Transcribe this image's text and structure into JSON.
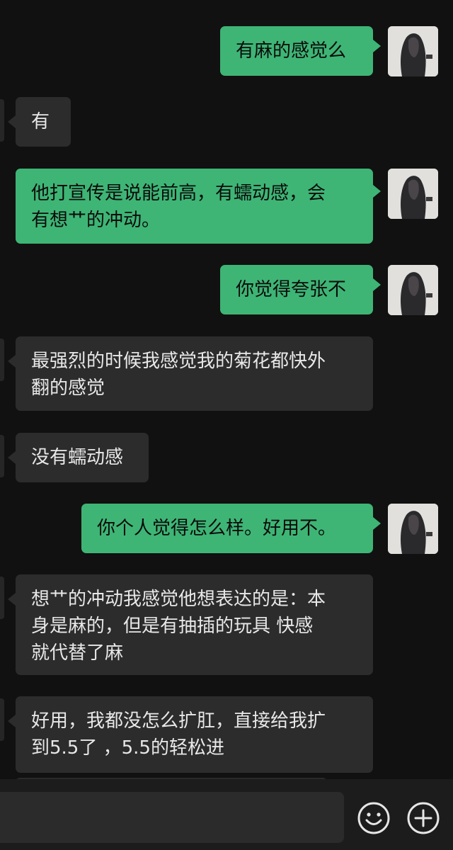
{
  "messages": [
    {
      "side": "out",
      "text": "有麻的感觉么"
    },
    {
      "side": "in",
      "text": "有"
    },
    {
      "side": "out",
      "text": "他打宣传是说能前高，有蠕动感，会\n有想艹的冲动。"
    },
    {
      "side": "out",
      "text": "你觉得夸张不"
    },
    {
      "side": "in",
      "text": "最强烈的时候我感觉我的菊花都快外\n翻的感觉"
    },
    {
      "side": "in",
      "text": "没有蠕动感"
    },
    {
      "side": "out",
      "text": "你个人觉得怎么样。好用不。"
    },
    {
      "side": "in",
      "text": "想艹的冲动我感觉他想表达的是：本\n身是麻的，但是有抽插的玩具 快感\n就代替了麻"
    },
    {
      "side": "in",
      "text": "好用，我都没怎么扩肛，直接给我扩\n到5.5了 ，5.5的轻松进"
    }
  ],
  "input_bar": {
    "value": "",
    "emoji_icon": "emoji-smile-icon",
    "plus_icon": "plus-circle-icon"
  },
  "colors": {
    "background": "#111111",
    "outgoing_bubble": "#3eb575",
    "incoming_bubble": "#2c2c2c",
    "incoming_text": "#e8e8e8",
    "outgoing_text": "#0b0b0b"
  }
}
